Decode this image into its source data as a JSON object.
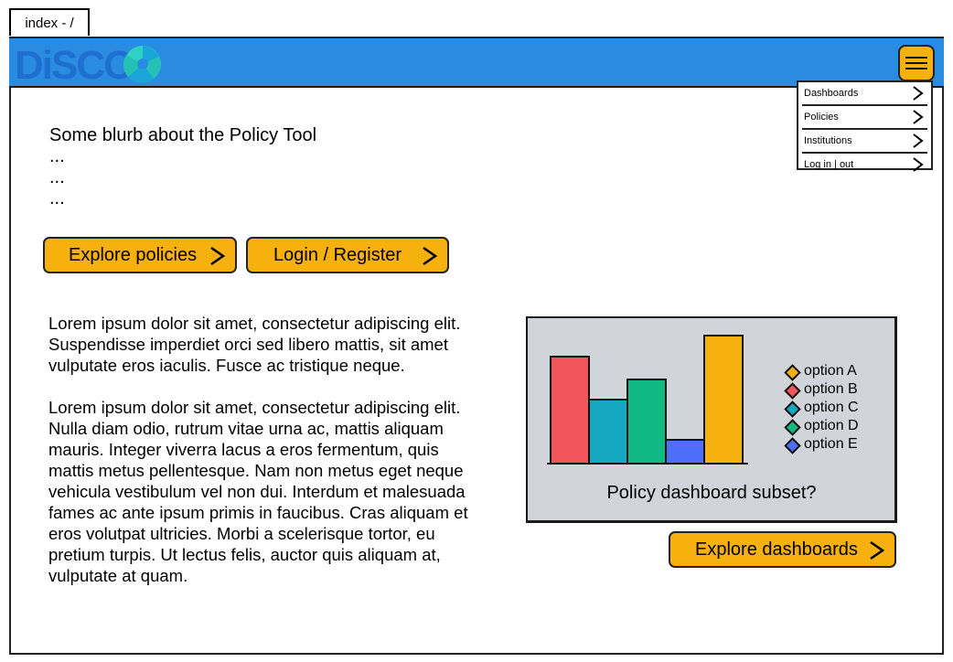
{
  "tab": {
    "label": "index - /"
  },
  "header": {
    "logo_text": "DiSCO",
    "colors": {
      "bar": "#2a8ce0",
      "accent": "#f7b10e"
    }
  },
  "menu": {
    "items": [
      {
        "label": "Dashboards"
      },
      {
        "label": "Policies"
      },
      {
        "label": "Institutions"
      },
      {
        "label": "Log in | out"
      }
    ]
  },
  "intro": {
    "title": "Some blurb about the Policy Tool",
    "lines": [
      "...",
      "...",
      "..."
    ]
  },
  "buttons": {
    "explore_policies": "Explore policies",
    "login_register": "Login / Register",
    "explore_dashboards": "Explore dashboards"
  },
  "content": {
    "paragraph_1": "Lorem ipsum dolor sit amet, consectetur adipiscing elit. Suspendisse imperdiet orci sed libero mattis, sit amet vulputate eros iaculis. Fusce ac tristique neque.",
    "paragraph_2": "Lorem ipsum dolor sit amet, consectetur adipiscing elit. Nulla diam odio, rutrum vitae urna ac, mattis aliquam mauris. Integer viverra lacus a eros fermentum, quis mattis metus pellentesque. Nam non metus eget neque vehicula vestibulum vel non dui. Interdum et malesuada fames ac ante ipsum primis in faucibus. Cras aliquam et eros volutpat ultricies. Morbi a scelerisque tortor, eu pretium turpis. Ut lectus felis, auctor quis aliquam at, vulputate at quam."
  },
  "dashboard": {
    "caption": "Policy dashboard subset?",
    "legend": [
      {
        "label": "option A",
        "color": "#f7b10e"
      },
      {
        "label": "option B",
        "color": "#f2545b"
      },
      {
        "label": "option C",
        "color": "#16a8c2"
      },
      {
        "label": "option D",
        "color": "#10b981"
      },
      {
        "label": "option E",
        "color": "#4f6ef7"
      }
    ]
  },
  "chart_data": {
    "type": "bar",
    "categories": [
      "option B",
      "option C",
      "option D",
      "option E",
      "option A"
    ],
    "values": [
      117,
      70,
      92,
      26,
      140
    ],
    "colors": [
      "#f2545b",
      "#16a8c2",
      "#10b981",
      "#4f6ef7",
      "#f7b10e"
    ],
    "ylim": [
      0,
      140
    ],
    "grid": false,
    "legend_position": "right"
  }
}
